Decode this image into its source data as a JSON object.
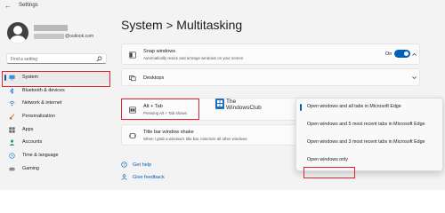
{
  "window": {
    "title": "Settings"
  },
  "account": {
    "email_suffix": "@outlook.com"
  },
  "search": {
    "placeholder": "Find a setting"
  },
  "sidebar": {
    "items": [
      {
        "label": "System",
        "icon": "monitor-icon",
        "active": true
      },
      {
        "label": "Bluetooth & devices",
        "icon": "bluetooth-icon"
      },
      {
        "label": "Network & internet",
        "icon": "network-icon"
      },
      {
        "label": "Personalization",
        "icon": "brush-icon"
      },
      {
        "label": "Apps",
        "icon": "apps-icon"
      },
      {
        "label": "Accounts",
        "icon": "person-icon"
      },
      {
        "label": "Time & language",
        "icon": "clock-icon"
      },
      {
        "label": "Gaming",
        "icon": "gamepad-icon"
      }
    ]
  },
  "breadcrumb": {
    "parent": "System",
    "separator": ">",
    "current": "Multitasking"
  },
  "settings": {
    "snap": {
      "title": "Snap windows",
      "subtitle": "Automatically resize and arrange windows on your screen",
      "toggle_label": "On",
      "toggle_on": true
    },
    "desktops": {
      "title": "Desktops"
    },
    "alttab": {
      "title": "Alt + Tab",
      "subtitle": "Pressing Alt + Tab shows"
    },
    "shake": {
      "title": "Title bar window shake",
      "subtitle": "When I grab a window's title bar, minimize all other windows"
    }
  },
  "watermark": {
    "line1": "The",
    "line2": "WindowsClub"
  },
  "dropdown": {
    "options": [
      {
        "label": "Open windows and all tabs in Microsoft Edge",
        "selected": true
      },
      {
        "label": "Open windows and 5 most recent tabs in Microsoft Edge"
      },
      {
        "label": "Open windows and 3 most recent tabs in Microsoft Edge"
      },
      {
        "label": "Open windows only"
      }
    ]
  },
  "help": {
    "get_help": "Get help",
    "give_feedback": "Give feedback"
  },
  "colors": {
    "accent": "#005fb8",
    "highlight": "#e0242f",
    "background": "#f3f3f3"
  }
}
